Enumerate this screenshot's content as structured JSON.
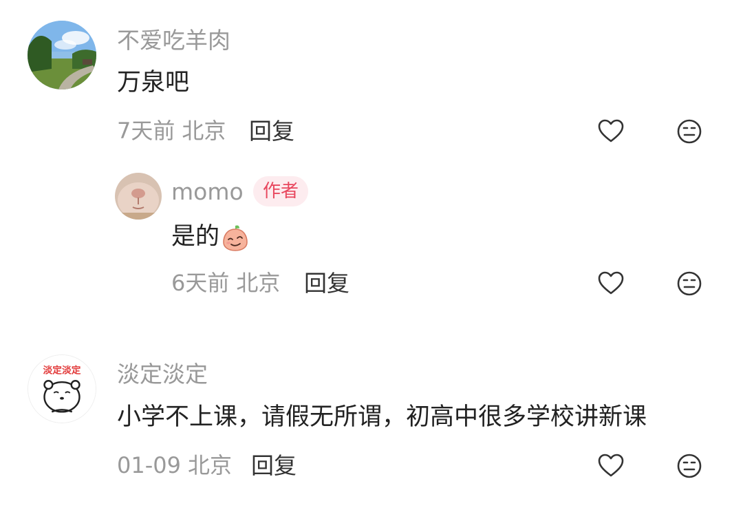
{
  "comments": [
    {
      "username": "不爱吃羊肉",
      "text": "万泉吧",
      "time": "7天前",
      "location": "北京",
      "reply_label": "回复",
      "avatar_icon": "park-path-landscape",
      "replies": [
        {
          "username": "momo",
          "badge": "作者",
          "text": "是的",
          "emoji_icon": "peach-sly-smile-emoji",
          "time": "6天前",
          "location": "北京",
          "reply_label": "回复",
          "avatar_icon": "cat-nose-closeup"
        }
      ]
    },
    {
      "username": "淡定淡定",
      "text": "小学不上课，请假无所谓，初高中很多学校讲新课",
      "time": "01-09",
      "location": "北京",
      "reply_label": "回复",
      "avatar_icon": "calm-bear-sticker",
      "avatar_text": "淡定淡定"
    }
  ],
  "icons": {
    "like": "heart-outline-icon",
    "dislike": "meh-face-icon"
  },
  "colors": {
    "username": "#999999",
    "content": "#222222",
    "badge_bg": "#fdecef",
    "badge_text": "#e8475e"
  }
}
